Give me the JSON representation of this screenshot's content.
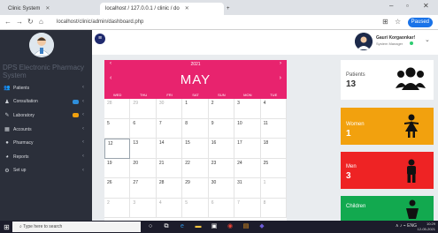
{
  "browser": {
    "tabs": [
      {
        "title": "Clinic System"
      },
      {
        "title": "localhost / 127.0.0.1 / clinic / do"
      }
    ],
    "new_tab": "+",
    "url": "localhost/clinic/admin/dashboard.php",
    "paused_label": "Paused"
  },
  "sidebar": {
    "system_name": "DPS Electronic Pharmacy System",
    "items": [
      {
        "label": "Patients",
        "icon": "users-icon",
        "badge_color": ""
      },
      {
        "label": "Consultation",
        "icon": "user-plus-icon",
        "badge_color": "#2f8fdc"
      },
      {
        "label": "Laboratory",
        "icon": "pen-icon",
        "badge_color": "#f0a10e"
      },
      {
        "label": "Accounts",
        "icon": "table-icon",
        "badge_color": ""
      },
      {
        "label": "Pharmacy",
        "icon": "pill-icon",
        "badge_color": ""
      },
      {
        "label": "Reports",
        "icon": "chart-icon",
        "badge_color": ""
      },
      {
        "label": "Set up",
        "icon": "gears-icon",
        "badge_color": ""
      }
    ]
  },
  "topbar": {
    "user_name": "Gauri Korgaonkar!",
    "user_role": "System Manager"
  },
  "calendar": {
    "year": "2021",
    "month": "MAY",
    "weekdays": [
      "WED",
      "THU",
      "FRI",
      "SAT",
      "SUN",
      "MON",
      "TUE"
    ],
    "days": [
      {
        "n": "28",
        "other": true
      },
      {
        "n": "29",
        "other": true
      },
      {
        "n": "30",
        "other": true
      },
      {
        "n": "1"
      },
      {
        "n": "2"
      },
      {
        "n": "3"
      },
      {
        "n": "4"
      },
      {
        "n": "5"
      },
      {
        "n": "6"
      },
      {
        "n": "7"
      },
      {
        "n": "8"
      },
      {
        "n": "9"
      },
      {
        "n": "10"
      },
      {
        "n": "11"
      },
      {
        "n": "12",
        "today": true
      },
      {
        "n": "13"
      },
      {
        "n": "14"
      },
      {
        "n": "15"
      },
      {
        "n": "16"
      },
      {
        "n": "17"
      },
      {
        "n": "18"
      },
      {
        "n": "19"
      },
      {
        "n": "20"
      },
      {
        "n": "21"
      },
      {
        "n": "22"
      },
      {
        "n": "23"
      },
      {
        "n": "24"
      },
      {
        "n": "25"
      },
      {
        "n": "26"
      },
      {
        "n": "27"
      },
      {
        "n": "28"
      },
      {
        "n": "29"
      },
      {
        "n": "30"
      },
      {
        "n": "31"
      },
      {
        "n": "1",
        "other": true
      },
      {
        "n": "2",
        "other": true
      },
      {
        "n": "3",
        "other": true
      },
      {
        "n": "4",
        "other": true
      },
      {
        "n": "5",
        "other": true
      },
      {
        "n": "6",
        "other": true
      },
      {
        "n": "7",
        "other": true
      },
      {
        "n": "8",
        "other": true
      }
    ],
    "accent_color": "#e8236e"
  },
  "stats": {
    "patients": {
      "label": "Patients",
      "value": "13",
      "color": "#ffffff"
    },
    "women": {
      "label": "Women",
      "value": "1",
      "color": "#f2a10e"
    },
    "men": {
      "label": "Men",
      "value": "3",
      "color": "#ee2324"
    },
    "children": {
      "label": "Children",
      "value": "",
      "color": "#12a94f"
    }
  },
  "taskbar": {
    "search_placeholder": "Type here to search",
    "tray": "ENG",
    "time": "10:29",
    "date": "12-05-2021"
  }
}
